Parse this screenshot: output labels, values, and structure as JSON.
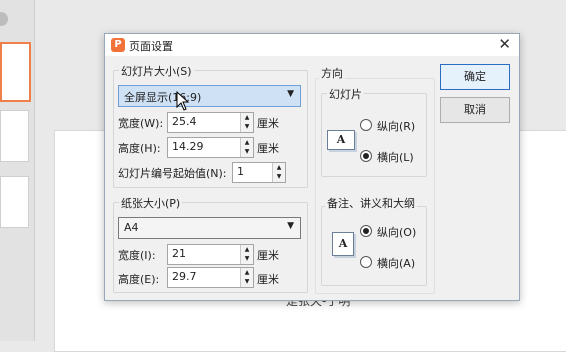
{
  "dialog": {
    "title": "页面设置",
    "app_icon_letter": "P",
    "slide_size": {
      "legend": "幻灯片大小(S)",
      "selected": "全屏显示(16:9)",
      "width_label": "宽度(W):",
      "width_value": "25.4",
      "height_label": "高度(H):",
      "height_value": "14.29",
      "unit": "厘米",
      "start_number_label": "幻灯片编号起始值(N):",
      "start_number_value": "1"
    },
    "paper_size": {
      "legend": "纸张大小(P)",
      "selected": "A4",
      "width_label": "宽度(I):",
      "width_value": "21",
      "height_label": "高度(E):",
      "height_value": "29.7",
      "unit": "厘米"
    },
    "orientation": {
      "legend": "方向",
      "slides": {
        "legend": "幻灯片",
        "portrait": "纵向(R)",
        "landscape": "横向(L)",
        "selected": "landscape"
      },
      "notes": {
        "legend": "备注、讲义和大纲",
        "portrait": "纵向(O)",
        "landscape": "横向(A)",
        "selected": "portrait"
      },
      "icon_letter": "A"
    },
    "ok_label": "确定",
    "cancel_label": "取消"
  },
  "background": {
    "text": "是张天-于明"
  },
  "colors": {
    "accent": "#f07f4a",
    "primary_border": "#2b6cc4"
  }
}
